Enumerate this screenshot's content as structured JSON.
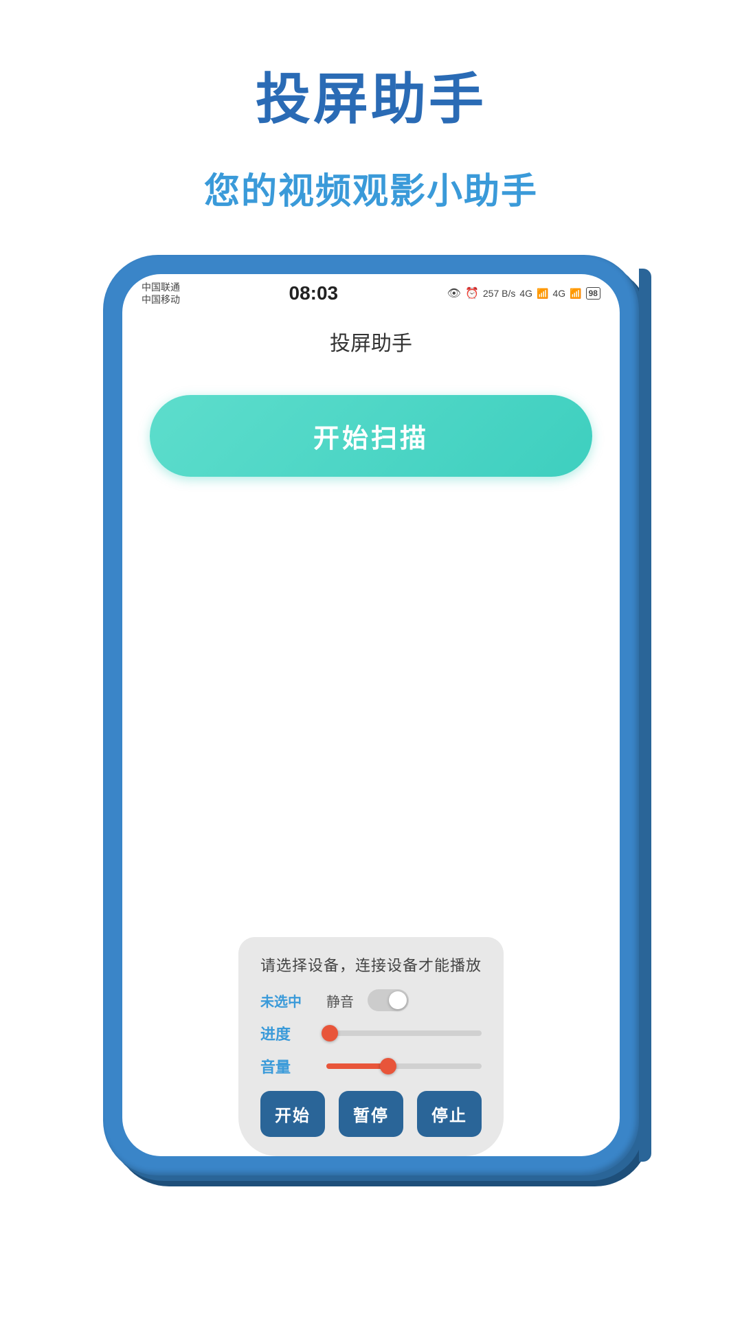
{
  "app": {
    "main_title": "投屏助手",
    "subtitle": "您的视频观影小助手",
    "screen_title": "投屏助手",
    "scan_button_label": "开始扫描"
  },
  "status_bar": {
    "carrier1": "中国联通",
    "carrier2": "中国移动",
    "time": "08:03",
    "speed": "257 B/s",
    "signal1": "4G",
    "signal2": "4G",
    "battery": "98"
  },
  "bottom_panel": {
    "hint": "请选择设备，连接设备才能播放",
    "unselected_label": "未选中",
    "mute_label": "静音",
    "progress_label": "进度",
    "volume_label": "音量",
    "progress_value": 2,
    "volume_value": 40,
    "btn_start": "开始",
    "btn_pause": "暂停",
    "btn_stop": "停止"
  }
}
